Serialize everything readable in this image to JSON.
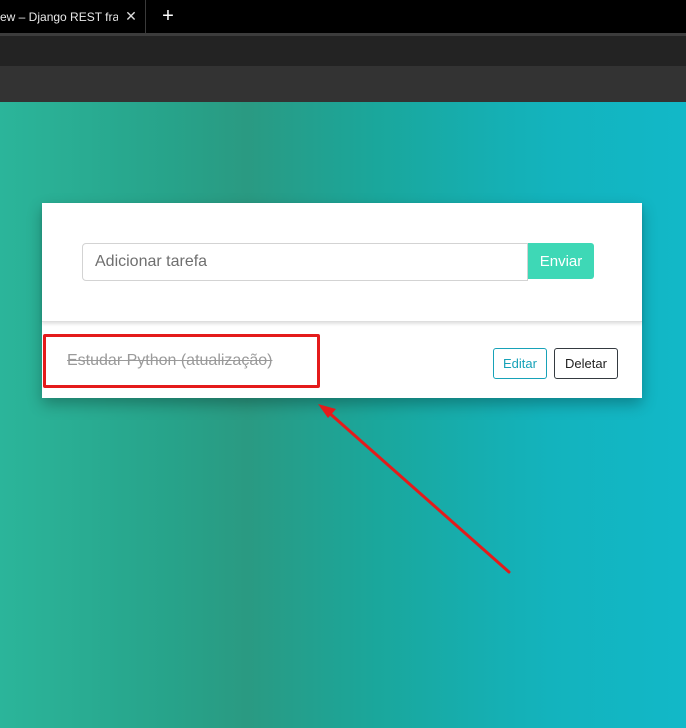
{
  "browser": {
    "tab_title": "ew – Django REST fran",
    "close_glyph": "✕",
    "new_tab_glyph": "+"
  },
  "form": {
    "input_placeholder": "Adicionar tarefa",
    "input_value": "",
    "submit_label": "Enviar"
  },
  "tasks": [
    {
      "title": "Estudar Python (atualização)",
      "completed": true,
      "edit_label": "Editar",
      "delete_label": "Deletar"
    }
  ],
  "colors": {
    "annotation": "#e41b1b",
    "submit_button": "#3ed8b6",
    "edit_button": "#17a2b8"
  }
}
